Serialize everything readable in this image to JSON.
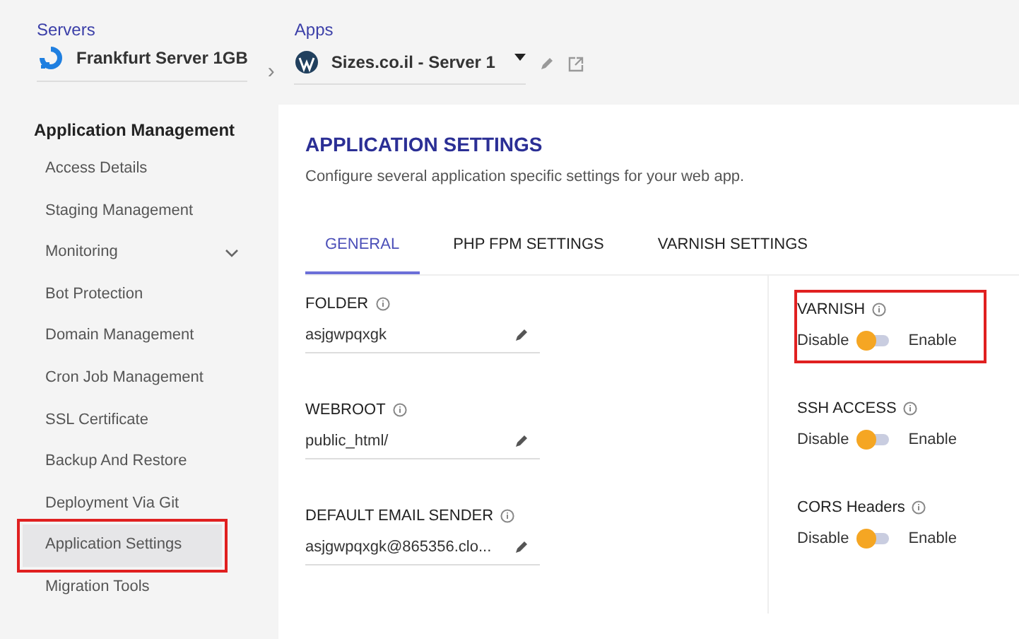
{
  "breadcrumb": {
    "servers_label": "Servers",
    "server": "Frankfurt Server 1GB",
    "separator": "›",
    "apps_label": "Apps",
    "app": "Sizes.co.il - Server 1"
  },
  "sidebar": {
    "heading": "Application Management",
    "items": [
      {
        "label": "Access Details",
        "selected": false,
        "highlighted": false,
        "expandable": false
      },
      {
        "label": "Staging Management",
        "selected": false,
        "highlighted": false,
        "expandable": false
      },
      {
        "label": "Monitoring",
        "selected": false,
        "highlighted": false,
        "expandable": true
      },
      {
        "label": "Bot Protection",
        "selected": false,
        "highlighted": false,
        "expandable": false
      },
      {
        "label": "Domain Management",
        "selected": false,
        "highlighted": false,
        "expandable": false
      },
      {
        "label": "Cron Job Management",
        "selected": false,
        "highlighted": false,
        "expandable": false
      },
      {
        "label": "SSL Certificate",
        "selected": false,
        "highlighted": false,
        "expandable": false
      },
      {
        "label": "Backup And Restore",
        "selected": false,
        "highlighted": false,
        "expandable": false
      },
      {
        "label": "Deployment Via Git",
        "selected": false,
        "highlighted": false,
        "expandable": false
      },
      {
        "label": "Application Settings",
        "selected": true,
        "highlighted": true,
        "expandable": false
      },
      {
        "label": "Migration Tools",
        "selected": false,
        "highlighted": false,
        "expandable": false
      }
    ]
  },
  "panel": {
    "title": "APPLICATION SETTINGS",
    "description": "Configure several application specific settings for your web app.",
    "tabs": [
      {
        "label": "GENERAL",
        "selected": true
      },
      {
        "label": "PHP FPM SETTINGS",
        "selected": false
      },
      {
        "label": "VARNISH SETTINGS",
        "selected": false
      }
    ],
    "fields": [
      {
        "label": "FOLDER",
        "value": "asjgwpqxgk"
      },
      {
        "label": "WEBROOT",
        "value": "public_html/"
      },
      {
        "label": "DEFAULT EMAIL SENDER",
        "value": "asjgwpqxgk@865356.clo..."
      }
    ],
    "toggles": [
      {
        "label": "VARNISH",
        "off_label": "Disable",
        "on_label": "Enable",
        "on": false,
        "highlighted": true
      },
      {
        "label": "SSH ACCESS",
        "off_label": "Disable",
        "on_label": "Enable",
        "on": false,
        "highlighted": false
      },
      {
        "label": "CORS Headers",
        "off_label": "Disable",
        "on_label": "Enable",
        "on": false,
        "highlighted": false
      }
    ]
  }
}
